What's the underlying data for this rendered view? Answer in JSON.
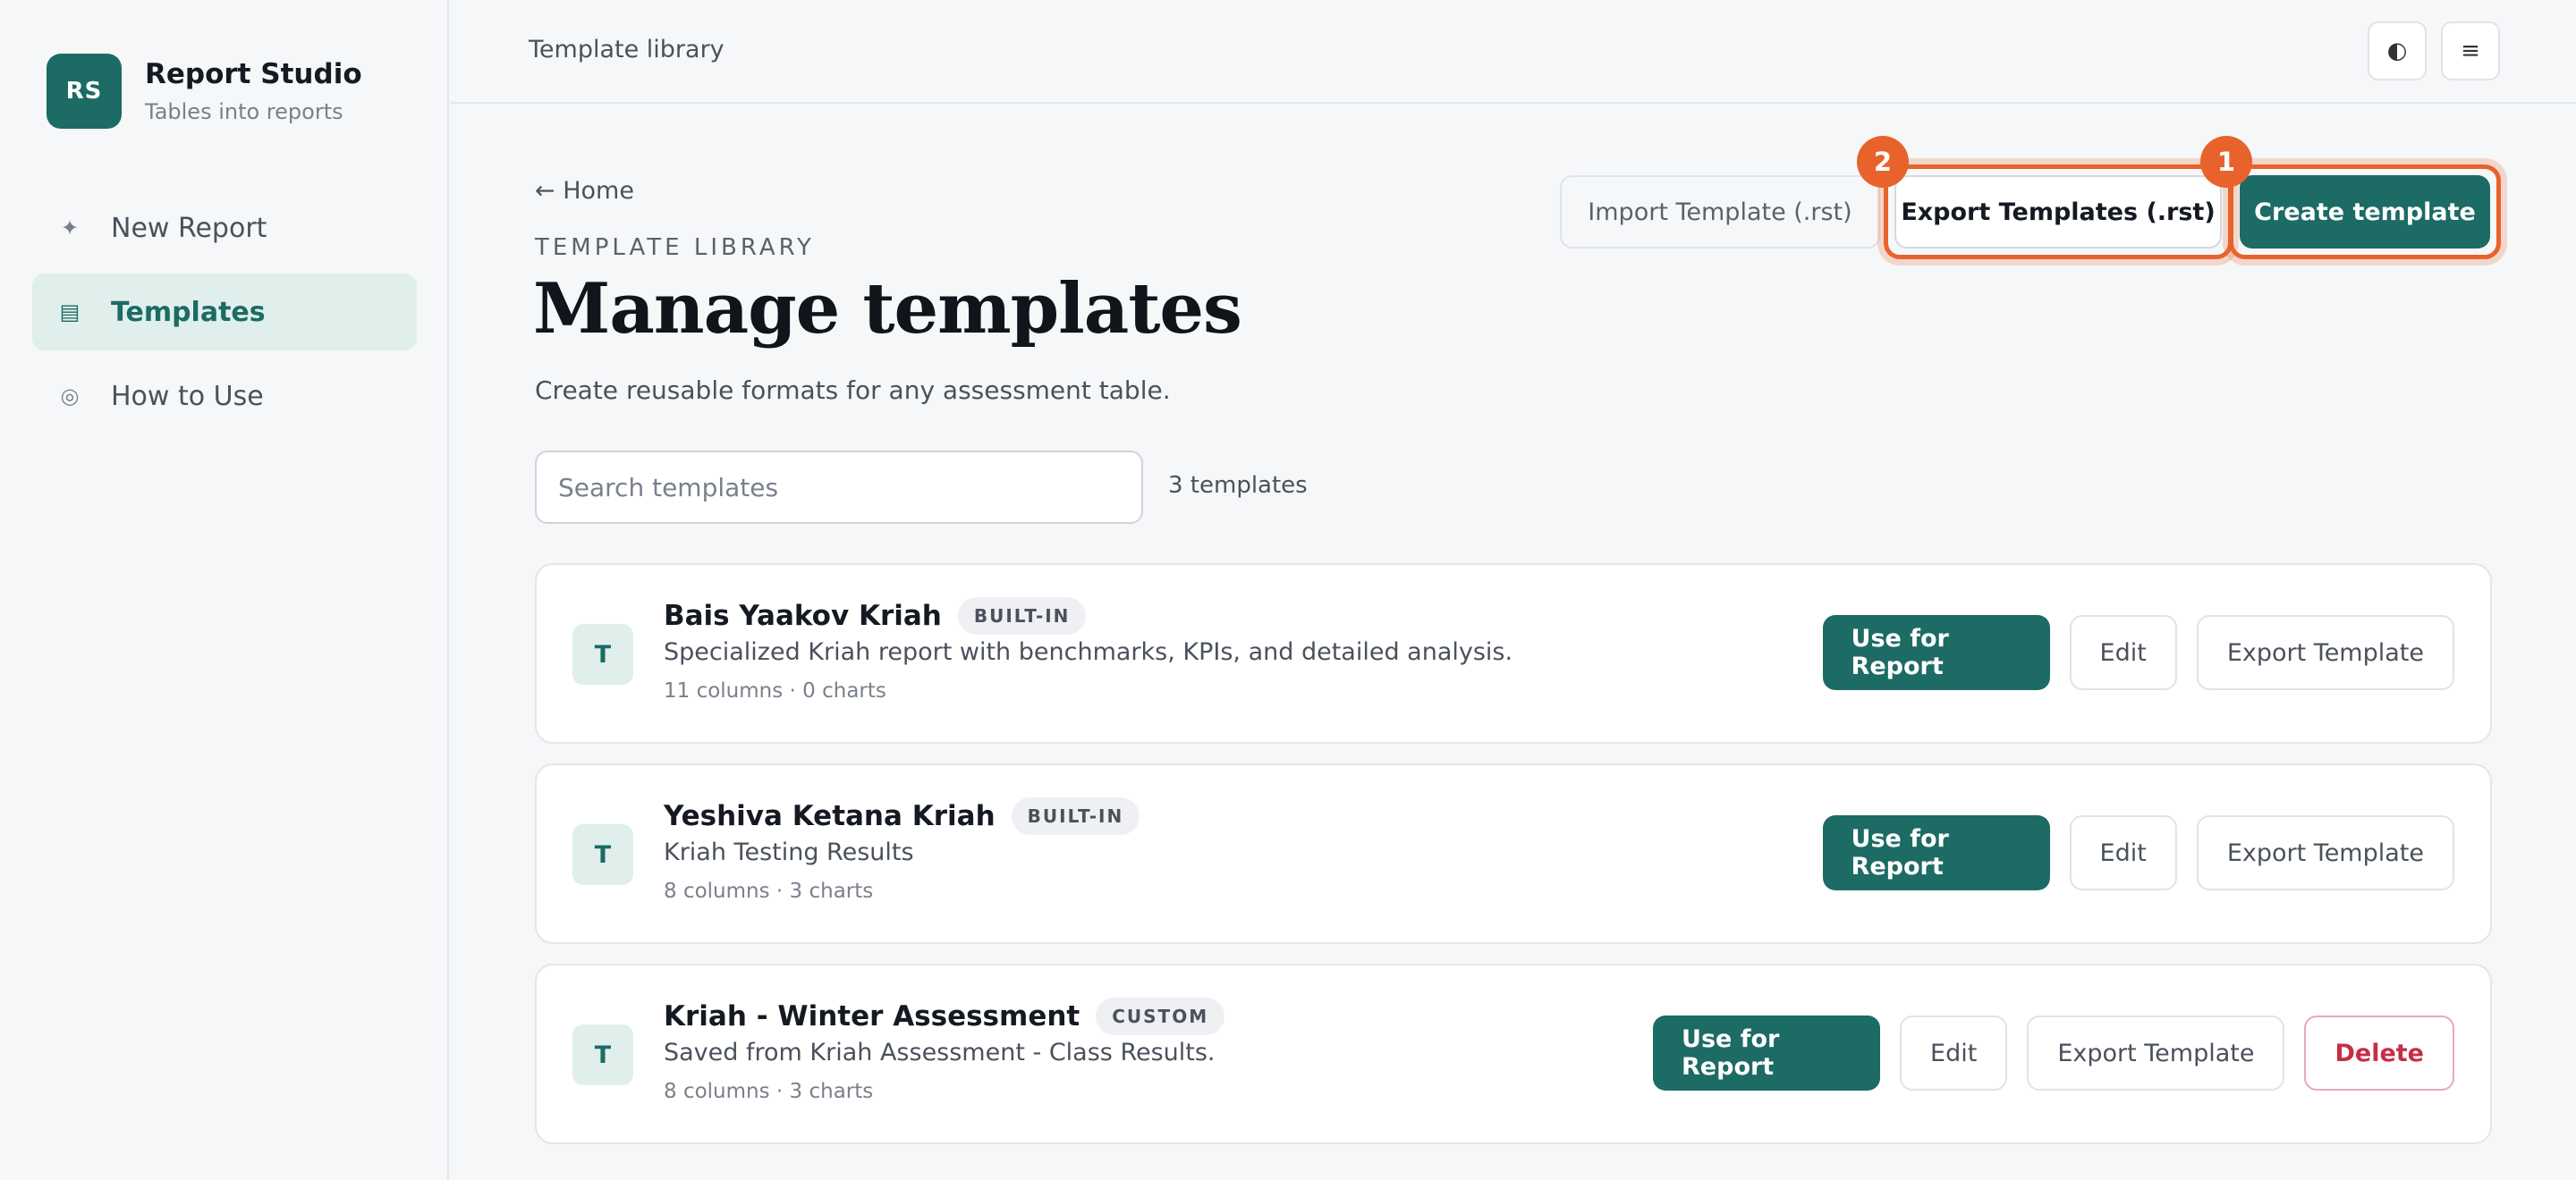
{
  "app": {
    "logo_initials": "RS",
    "name": "Report Studio",
    "tagline": "Tables into reports"
  },
  "sidebar": {
    "items": [
      {
        "label": "New Report",
        "icon": "sparkle-icon",
        "glyph": "✦",
        "active": false
      },
      {
        "label": "Templates",
        "icon": "list-icon",
        "glyph": "▤",
        "active": true
      },
      {
        "label": "How to Use",
        "icon": "help-circle-icon",
        "glyph": "◎",
        "active": false
      }
    ]
  },
  "topbar": {
    "title": "Template library",
    "theme_toggle_glyph": "◐",
    "menu_glyph": "≡"
  },
  "main": {
    "back_link": "← Home",
    "eyebrow": "TEMPLATE LIBRARY",
    "title": "Manage templates",
    "subtitle": "Create reusable formats for any assessment table.",
    "actions": {
      "import_label": "Import Template (.rst)",
      "export_all_label": "Export Templates (.rst)",
      "create_label": "Create template"
    },
    "annotations": {
      "create_badge": "1",
      "export_badge": "2",
      "highlight_color": "#e8632b"
    },
    "search": {
      "placeholder": "Search templates",
      "value": ""
    },
    "count_text": "3 templates"
  },
  "templates": [
    {
      "avatar": "T",
      "name": "Bais Yaakov Kriah",
      "tag": "BUILT-IN",
      "description": "Specialized Kriah report with benchmarks, KPIs, and detailed analysis.",
      "meta": "11 columns · 0 charts",
      "use_label": "Use for Report",
      "edit_label": "Edit",
      "export_label": "Export Template"
    },
    {
      "avatar": "T",
      "name": "Yeshiva Ketana Kriah",
      "tag": "BUILT-IN",
      "description": "Kriah Testing Results",
      "meta": "8 columns · 3 charts",
      "use_label": "Use for Report",
      "edit_label": "Edit",
      "export_label": "Export Template"
    },
    {
      "avatar": "T",
      "name": "Kriah - Winter Assessment",
      "tag": "CUSTOM",
      "description": "Saved from Kriah Assessment - Class Results.",
      "meta": "8 columns · 3 charts",
      "use_label": "Use for Report",
      "edit_label": "Edit",
      "export_label": "Export Template",
      "delete_label": "Delete"
    }
  ],
  "colors": {
    "brand": "#1c6b64",
    "brand_light": "#e0efec",
    "danger": "#c62e44",
    "accent": "#e8632b"
  }
}
